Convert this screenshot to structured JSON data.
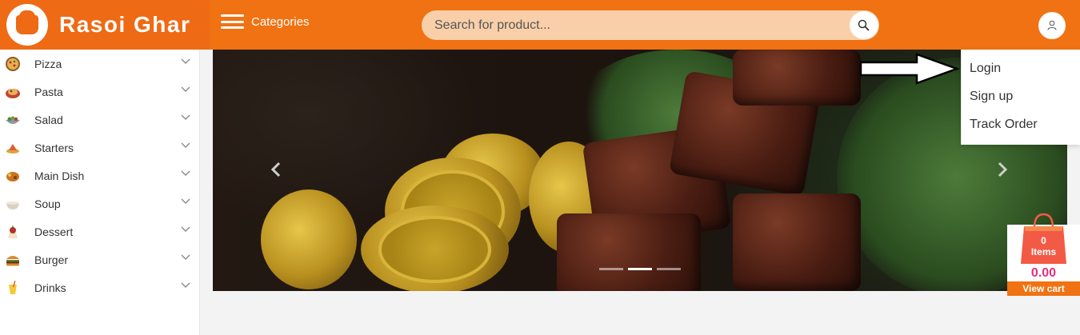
{
  "header": {
    "brand": "Rasoi Ghar",
    "categories_label": "Categories",
    "search": {
      "placeholder": "Search for product...",
      "value": ""
    }
  },
  "sidebar": {
    "items": [
      {
        "label": "Pizza",
        "icon": "pizza-icon"
      },
      {
        "label": "Pasta",
        "icon": "pasta-icon"
      },
      {
        "label": "Salad",
        "icon": "salad-icon"
      },
      {
        "label": "Starters",
        "icon": "starters-icon"
      },
      {
        "label": "Main Dish",
        "icon": "main-dish-icon"
      },
      {
        "label": "Soup",
        "icon": "soup-icon"
      },
      {
        "label": "Dessert",
        "icon": "dessert-icon"
      },
      {
        "label": "Burger",
        "icon": "burger-icon"
      },
      {
        "label": "Drinks",
        "icon": "drinks-icon"
      }
    ]
  },
  "user_menu": {
    "items": [
      "Login",
      "Sign up",
      "Track Order"
    ]
  },
  "carousel": {
    "slide_count": 3,
    "active_index": 1
  },
  "cart": {
    "count": "0",
    "items_label": "Items",
    "total": "0.00",
    "view_label": "View cart"
  },
  "colors": {
    "brand": "#f07212",
    "search_bg": "#f9cfa9",
    "cart_total": "#e0317e",
    "bag": "#f25a45"
  }
}
